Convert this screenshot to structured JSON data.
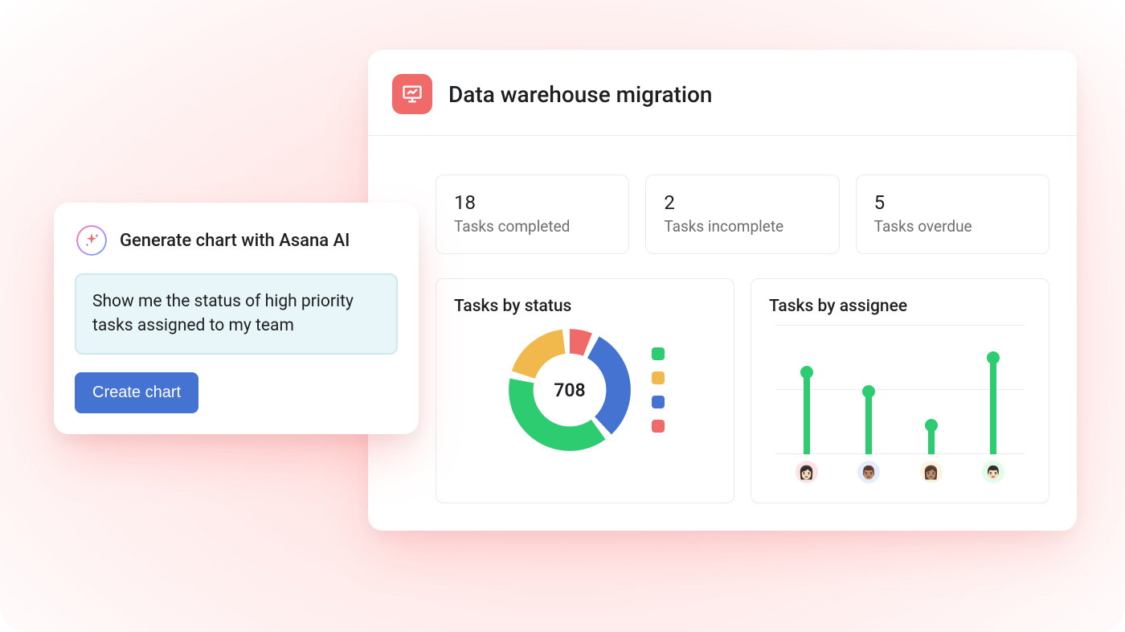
{
  "ai_card": {
    "title": "Generate chart with Asana AI",
    "prompt_text": "Show me the status of high priority tasks assigned to my team",
    "button_label": "Create chart"
  },
  "dashboard": {
    "title": "Data warehouse migration",
    "stats": [
      {
        "value": "18",
        "label": "Tasks completed"
      },
      {
        "value": "2",
        "label": "Tasks incomplete"
      },
      {
        "value": "5",
        "label": "Tasks overdue"
      }
    ],
    "status_chart": {
      "title": "Tasks by status",
      "center_value": "708"
    },
    "assignee_chart": {
      "title": "Tasks by assignee"
    }
  },
  "chart_data": [
    {
      "type": "pie",
      "title": "Tasks by status",
      "total": 708,
      "series": [
        {
          "name": "green",
          "value": 40,
          "color": "#2ecc71"
        },
        {
          "name": "yellow",
          "value": 20,
          "color": "#f1b94b"
        },
        {
          "name": "red",
          "value": 8,
          "color": "#f06a6a"
        },
        {
          "name": "blue",
          "value": 32,
          "color": "#4573d2"
        }
      ]
    },
    {
      "type": "bar",
      "title": "Tasks by assignee",
      "categories": [
        "assignee-1",
        "assignee-2",
        "assignee-3",
        "assignee-4"
      ],
      "values": [
        85,
        65,
        30,
        100
      ],
      "ylim": [
        0,
        100
      ],
      "color": "#2ecc71"
    }
  ]
}
